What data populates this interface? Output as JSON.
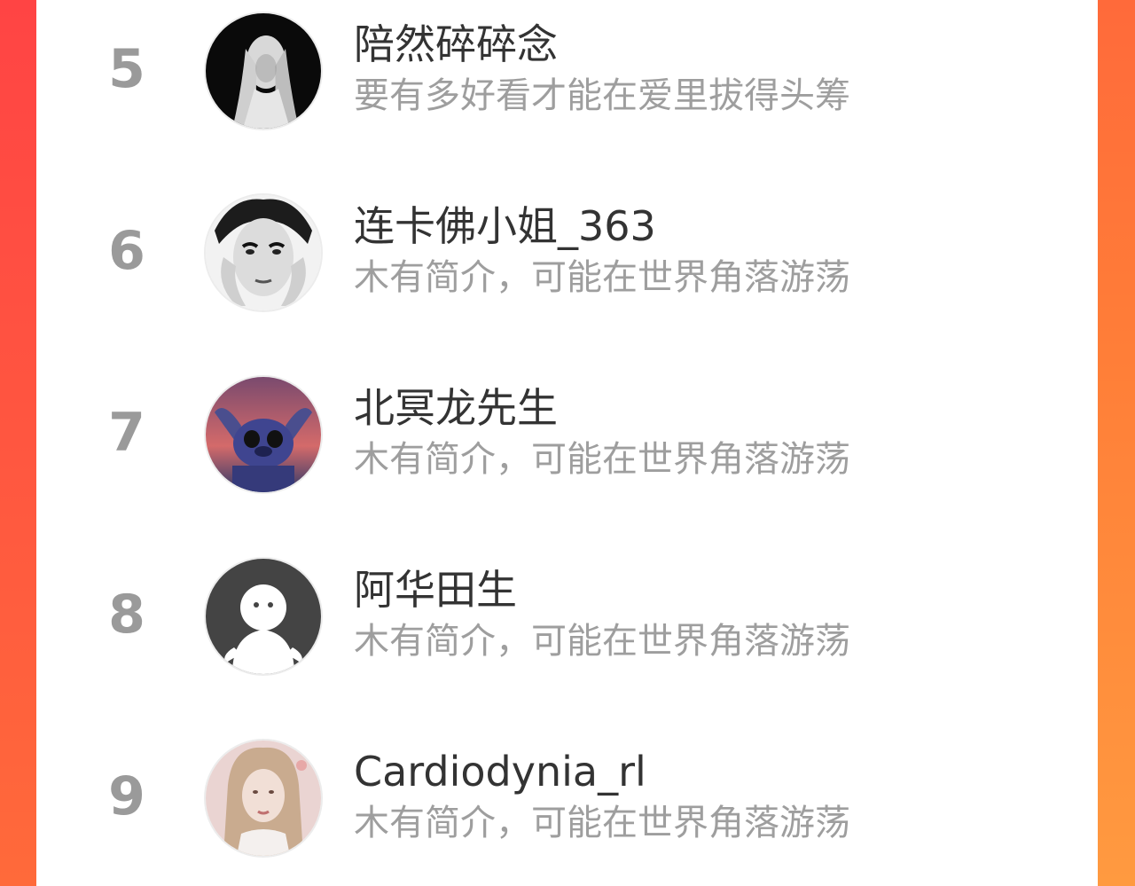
{
  "ranking": {
    "items": [
      {
        "rank": "5",
        "name": "陪然碎碎念",
        "bio": "要有多好看才能在爱里拔得头筹",
        "avatar_icon": "white-haired-girl-avatar"
      },
      {
        "rank": "6",
        "name": "连卡佛小姐_363",
        "bio": "木有简介，可能在世界角落游荡",
        "avatar_icon": "audrey-portrait-avatar"
      },
      {
        "rank": "7",
        "name": "北冥龙先生",
        "bio": "木有简介，可能在世界角落游荡",
        "avatar_icon": "stitch-cartoon-avatar"
      },
      {
        "rank": "8",
        "name": "阿华田生",
        "bio": "木有简介，可能在世界角落游荡",
        "avatar_icon": "default-user-avatar"
      },
      {
        "rank": "9",
        "name": "Cardiodynia_rl",
        "bio": "木有简介，可能在世界角落游荡",
        "avatar_icon": "girl-photo-avatar"
      }
    ]
  },
  "colors": {
    "background_left": "#ff4444",
    "background_right": "#ff8a3a",
    "rank_number": "#9a9a9a",
    "name_text": "#333333",
    "bio_text": "#9e9e9e"
  }
}
